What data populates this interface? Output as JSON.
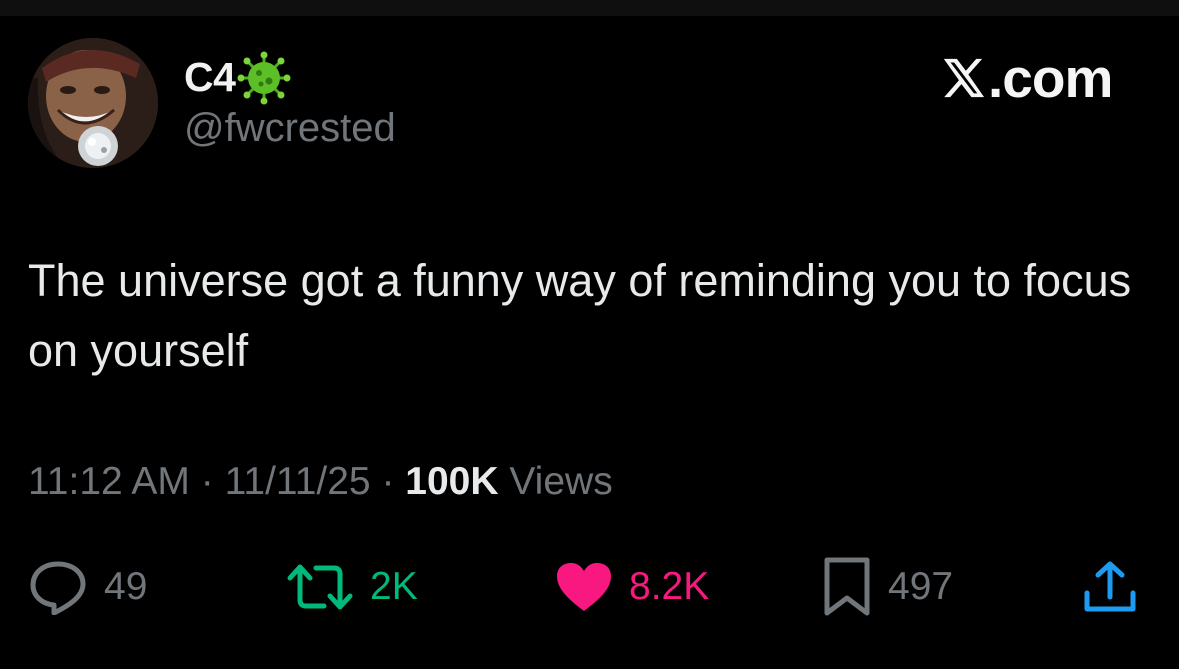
{
  "user": {
    "display_name": "C4",
    "handle": "@fwcrested",
    "badge_icon": "virus-emoji-icon"
  },
  "brand": {
    "text": ".com",
    "logo_icon": "x-logo-icon"
  },
  "tweet": {
    "text": "The universe got a funny way of reminding you to focus on yourself",
    "time": "11:12 AM",
    "date": "11/11/25",
    "separator": "·",
    "views_count": "100K",
    "views_label": "Views"
  },
  "actions": {
    "replies": "49",
    "reposts": "2K",
    "likes": "8.2K",
    "bookmarks": "497"
  },
  "colors": {
    "background": "#000000",
    "text": "#e7e9ea",
    "muted": "#71767b",
    "repost": "#00ba7c",
    "like": "#f91880",
    "share": "#1d9bf0"
  }
}
